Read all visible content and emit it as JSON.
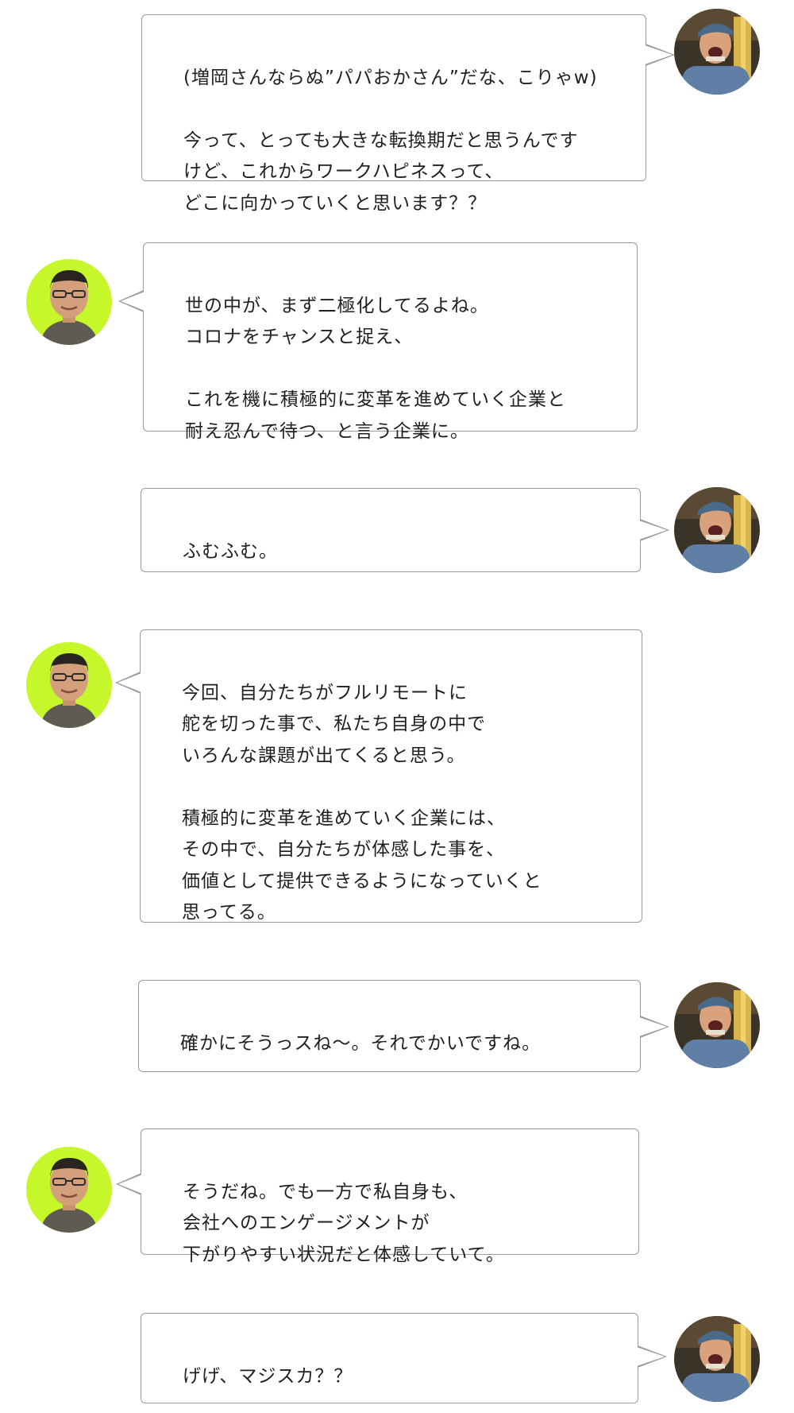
{
  "colors": {
    "bubble_border": "#9a9a9a",
    "host_avatar_bg": "#c5f72a",
    "text": "#1f1f1f"
  },
  "speakers": {
    "guest": {
      "avatar_icon": "interviewer-eating-noodles-avatar"
    },
    "host": {
      "avatar_icon": "man-with-glasses-avatar"
    }
  },
  "messages": [
    {
      "speaker": "guest",
      "text": "(増岡さんならぬ”パパおかさん”だな、こりゃw)\n\n今って、とっても大きな転換期だと思うんです\nけど、これからワークハピネスって、\nどこに向かっていくと思います？？"
    },
    {
      "speaker": "host",
      "text": "世の中が、まず二極化してるよね。\nコロナをチャンスと捉え、\n\nこれを機に積極的に変革を進めていく企業と\n耐え忍んで待つ、と言う企業に。"
    },
    {
      "speaker": "guest",
      "text": "ふむふむ。"
    },
    {
      "speaker": "host",
      "text": "今回、自分たちがフルリモートに\n舵を切った事で、私たち自身の中で\nいろんな課題が出てくると思う。\n\n積極的に変革を進めていく企業には、\nその中で、自分たちが体感した事を、\n価値として提供できるようになっていくと\n思ってる。"
    },
    {
      "speaker": "guest",
      "text": "確かにそうっスね〜。それでかいですね。"
    },
    {
      "speaker": "host",
      "text": "そうだね。でも一方で私自身も、\n会社へのエンゲージメントが\n下がりやすい状況だと体感していて。"
    },
    {
      "speaker": "guest",
      "text": "げげ、マジスカ？？"
    }
  ]
}
